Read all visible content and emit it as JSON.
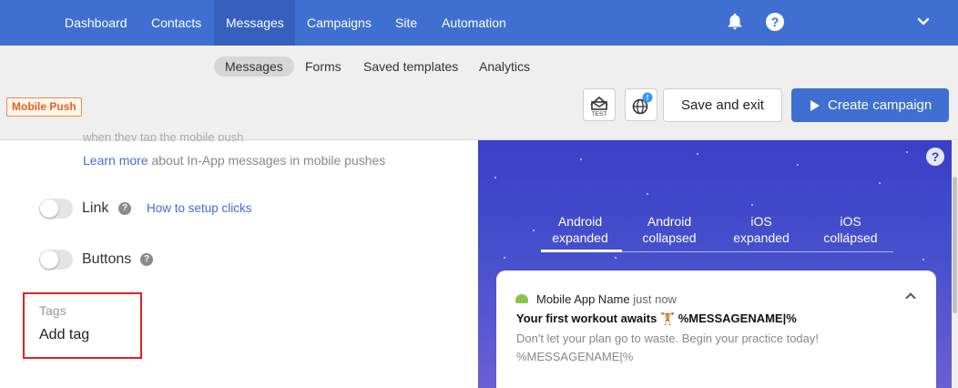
{
  "topnav": {
    "items": [
      "Dashboard",
      "Contacts",
      "Messages",
      "Campaigns",
      "Site",
      "Automation"
    ],
    "active": "Messages",
    "help_glyph": "?"
  },
  "subnav": {
    "items": [
      "Messages",
      "Forms",
      "Saved templates",
      "Analytics"
    ],
    "active": "Messages"
  },
  "channel_badge": "Mobile Push",
  "toolbar": {
    "test_label": "TEST",
    "globe_badge": "!",
    "save_label": "Save and exit",
    "create_label": "Create campaign"
  },
  "editor": {
    "cut_text": "when they tap the mobile push",
    "learn_link": "Learn more",
    "learn_rest": " about In-App messages in mobile pushes",
    "link_label": "Link",
    "howto_link": "How to setup clicks",
    "buttons_label": "Buttons",
    "help_glyph": "?",
    "tags_label": "Tags",
    "tags_value": "Add tag"
  },
  "preview": {
    "help_glyph": "?",
    "tabs": [
      {
        "line1": "Android",
        "line2": "expanded"
      },
      {
        "line1": "Android",
        "line2": "collapsed"
      },
      {
        "line1": "iOS",
        "line2": "expanded"
      },
      {
        "line1": "iOS",
        "line2": "collapsed"
      }
    ],
    "active_tab": "Android expanded",
    "notification": {
      "app_name": "Mobile App Name",
      "time": "just now",
      "title": "Your first workout awaits 🏋 %MESSAGENAME|%",
      "body": "Don't let your plan go to waste. Begin your practice today! %MESSAGENAME|%"
    }
  },
  "icons": {
    "bell": "bell-icon",
    "chevron": "chevron-down-icon",
    "test": "test-envelope-icon",
    "globe": "globe-icon",
    "play": "play-icon",
    "android": "android-icon",
    "collapse": "chevron-up-icon"
  },
  "colors": {
    "primary": "#3f6fd1",
    "badge": "#e8621c",
    "highlight_border": "#e02424",
    "preview_bg": "#3a3fc8"
  }
}
